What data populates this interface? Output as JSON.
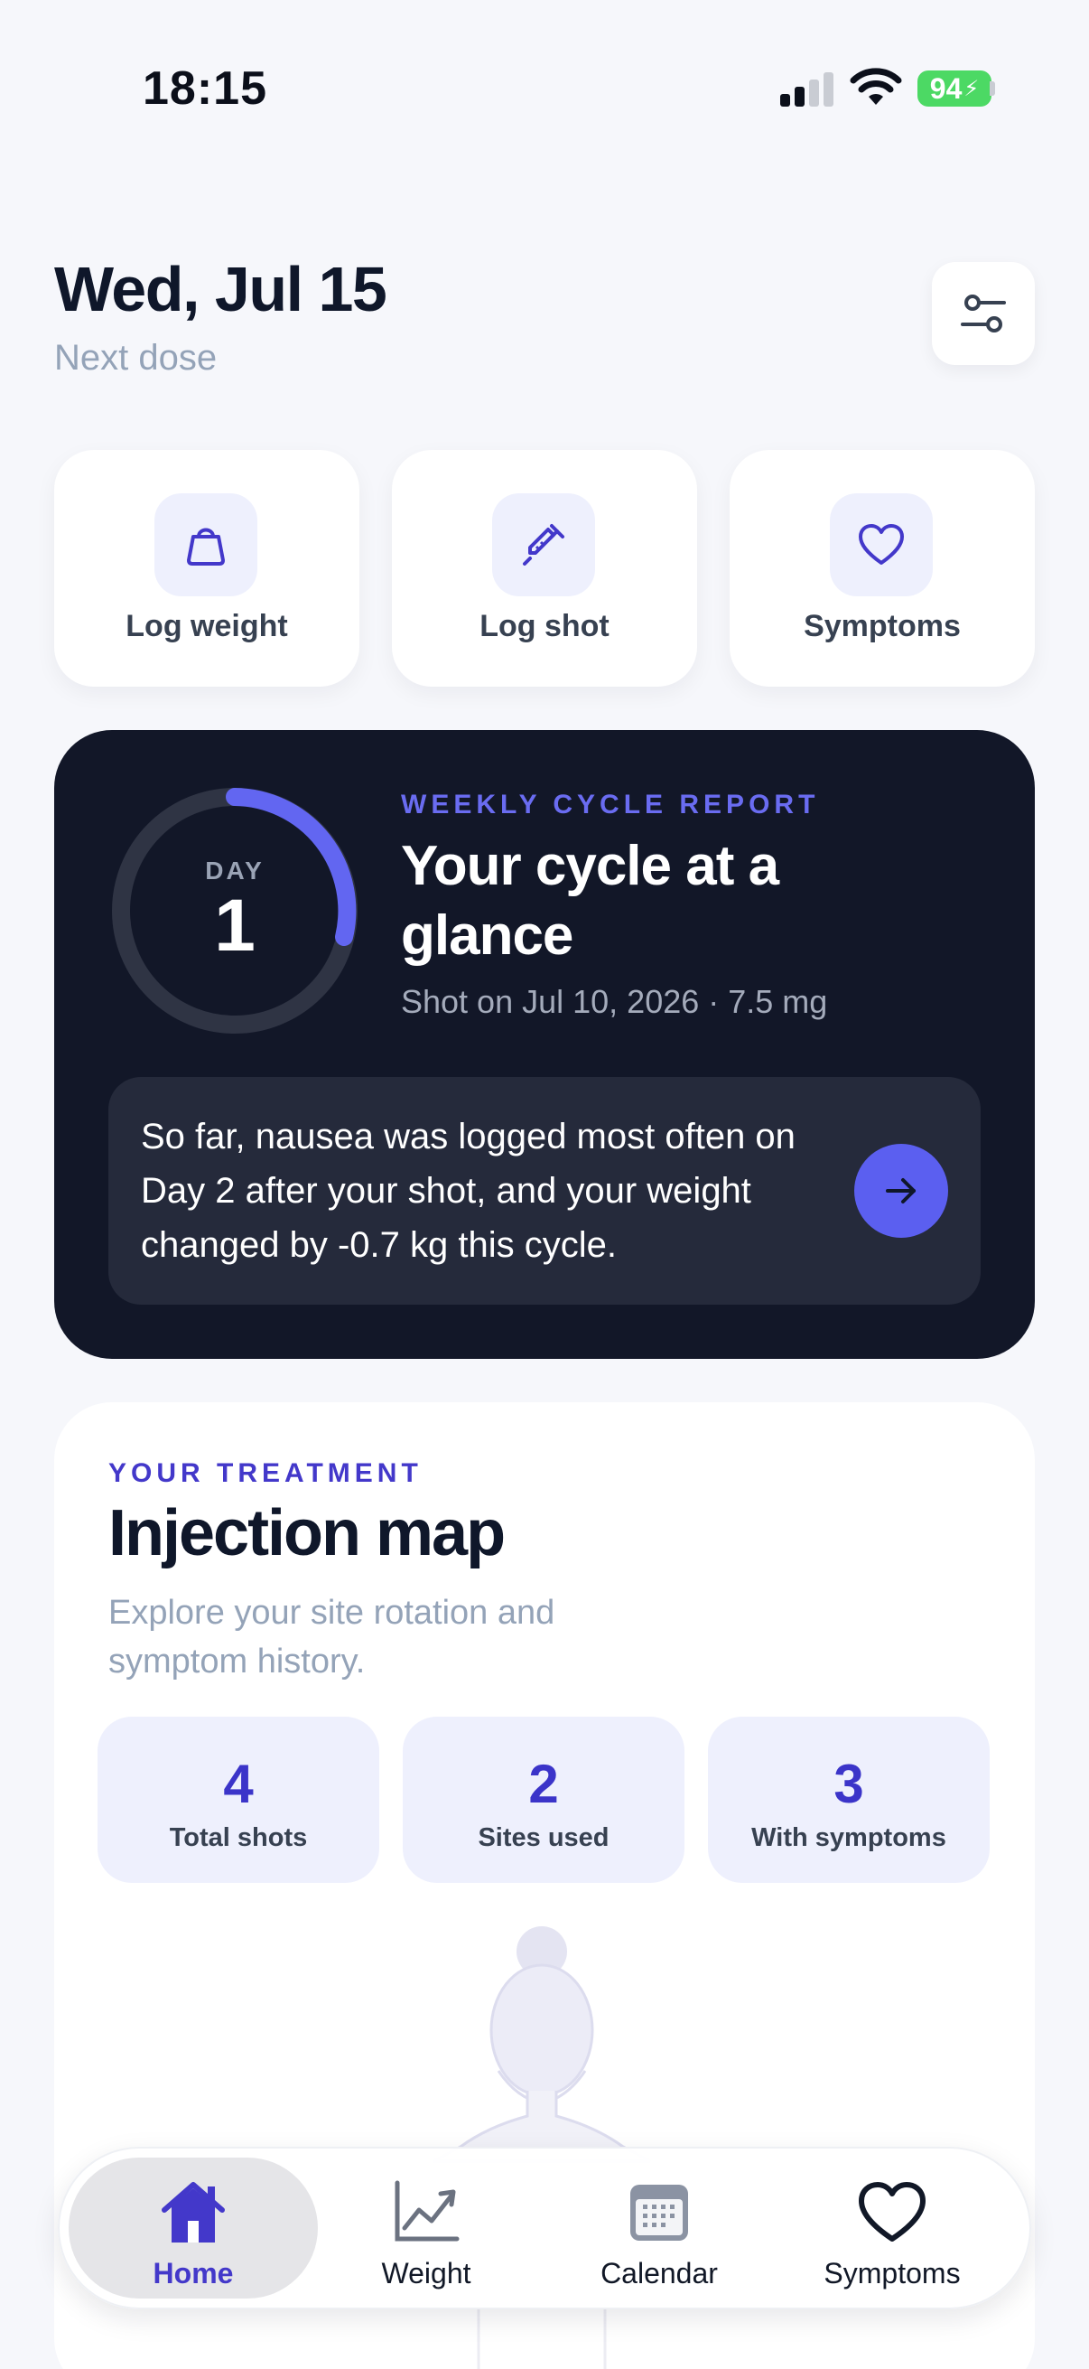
{
  "status_bar": {
    "time": "18:15",
    "battery": "94"
  },
  "header": {
    "date": "Wed, Jul 15",
    "subtitle": "Next dose"
  },
  "quick_actions": [
    {
      "label": "Log weight",
      "icon": "kettlebell-icon"
    },
    {
      "label": "Log shot",
      "icon": "syringe-icon"
    },
    {
      "label": "Symptoms",
      "icon": "heart-icon"
    }
  ],
  "report": {
    "eyebrow": "WEEKLY CYCLE REPORT",
    "title": "Your cycle at a glance",
    "subtitle": "Shot on Jul 10, 2026 · 7.5 mg",
    "day_label": "DAY",
    "day_number": "1",
    "insight": "So far, nausea was logged most often on Day 2 after your shot, and your weight changed by -0.7 kg this cycle."
  },
  "treatment": {
    "eyebrow": "YOUR TREATMENT",
    "title": "Injection map",
    "description": "Explore your site rotation and symptom history.",
    "stats": [
      {
        "value": "4",
        "label": "Total shots"
      },
      {
        "value": "2",
        "label": "Sites used"
      },
      {
        "value": "3",
        "label": "With symptoms"
      }
    ]
  },
  "tabs": [
    {
      "label": "Home",
      "icon": "home-icon",
      "active": true
    },
    {
      "label": "Weight",
      "icon": "chart-icon",
      "active": false
    },
    {
      "label": "Calendar",
      "icon": "calendar-icon",
      "active": false
    },
    {
      "label": "Symptoms",
      "icon": "heart-icon",
      "active": false
    }
  ],
  "colors": {
    "accent": "#5b5ff0",
    "accent_dark": "#4338ca",
    "card_dark": "#121728",
    "battery": "#4cd964"
  }
}
